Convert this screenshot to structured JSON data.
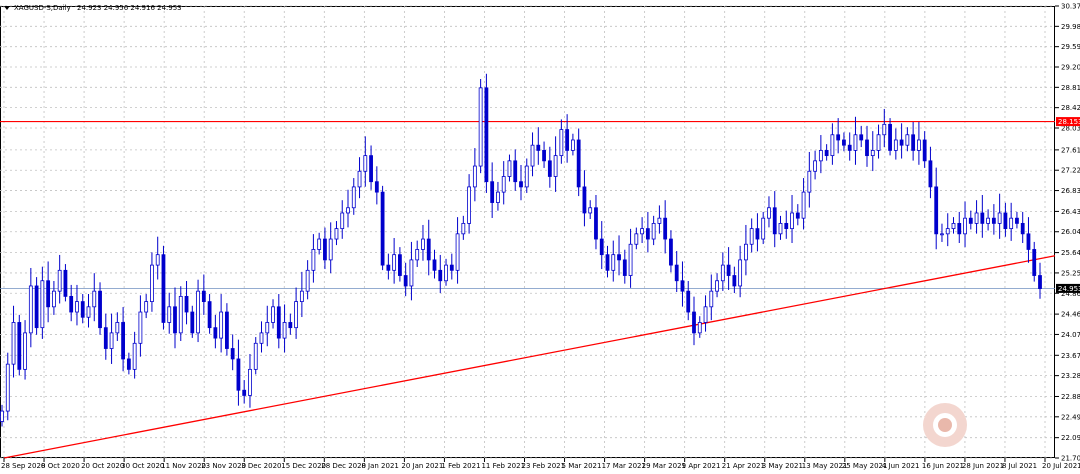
{
  "header": {
    "symbol": "XAGUSD-S,Daily",
    "ohlc": "24.923 24.956 24.916 24.953"
  },
  "colors": {
    "background": "#ffffff",
    "grid": "#c0c0c0",
    "candle": "#0000cc",
    "resistance": "#ff0000",
    "trendline": "#ff0000",
    "last_price_line": "#7090c0"
  },
  "chart_data": {
    "type": "candlestick",
    "title": "",
    "xlabel": "",
    "ylabel": "",
    "ylim": [
      21.7,
      30.37
    ],
    "grid": true,
    "y_ticks": [
      "30.370",
      "29.980",
      "29.590",
      "29.200",
      "28.810",
      "28.420",
      "28.030",
      "27.610",
      "27.220",
      "26.830",
      "26.430",
      "26.040",
      "25.640",
      "25.250",
      "24.860",
      "24.460",
      "24.070",
      "23.670",
      "23.280",
      "22.880",
      "22.490",
      "22.090",
      "21.700"
    ],
    "x_ticks": [
      "28 Sep 2020",
      "8 Oct 2020",
      "20 Oct 2020",
      "30 Oct 2020",
      "11 Nov 2020",
      "23 Nov 2020",
      "3 Dec 2020",
      "15 Dec 2020",
      "28 Dec 2020",
      "8 Jan 2021",
      "20 Jan 2021",
      "1 Feb 2021",
      "11 Feb 2021",
      "23 Feb 2021",
      "5 Mar 2021",
      "17 Mar 2021",
      "29 Mar 2021",
      "9 Apr 2021",
      "21 Apr 2021",
      "3 May 2021",
      "13 May 2021",
      "25 May 2021",
      "4 Jun 2021",
      "16 Jun 2021",
      "28 Jun 2021",
      "8 Jul 2021",
      "20 Jul 2021"
    ],
    "horizontal_line": {
      "value": 28.153,
      "label": "28.153"
    },
    "current_price": {
      "value": 24.953,
      "label": "24.953"
    },
    "trendline": {
      "start": {
        "date": "28 Sep 2020",
        "price": 21.7
      },
      "end": {
        "date": "20 Jul 2021",
        "price": 25.58
      }
    },
    "closes": [
      22.6,
      23.5,
      24.3,
      23.4,
      24.1,
      25.0,
      24.2,
      25.1,
      24.6,
      24.9,
      25.3,
      24.8,
      24.5,
      24.7,
      24.4,
      24.6,
      24.9,
      24.2,
      23.8,
      24.1,
      24.3,
      23.6,
      23.4,
      23.9,
      24.5,
      24.7,
      25.4,
      25.6,
      24.3,
      24.6,
      24.1,
      24.8,
      24.5,
      24.1,
      24.9,
      24.7,
      24.2,
      24.0,
      24.5,
      23.8,
      23.6,
      23.0,
      22.9,
      23.4,
      23.9,
      24.1,
      24.3,
      24.6,
      24.0,
      24.3,
      24.2,
      24.7,
      24.9,
      25.3,
      25.7,
      25.9,
      25.5,
      25.9,
      26.1,
      26.4,
      26.5,
      26.9,
      27.2,
      27.5,
      27.0,
      26.8,
      25.4,
      25.3,
      25.6,
      25.2,
      25.0,
      25.5,
      25.7,
      25.9,
      25.5,
      25.3,
      25.1,
      25.4,
      25.3,
      26.0,
      26.2,
      26.9,
      27.3,
      28.8,
      27.0,
      26.6,
      26.8,
      27.1,
      27.4,
      27.0,
      26.9,
      27.3,
      27.7,
      27.6,
      27.4,
      27.1,
      27.5,
      28.0,
      27.6,
      27.8,
      26.9,
      26.4,
      26.5,
      25.9,
      25.6,
      25.3,
      25.6,
      25.5,
      25.2,
      25.8,
      26.0,
      26.1,
      25.9,
      26.2,
      26.3,
      25.9,
      25.4,
      25.1,
      24.9,
      24.5,
      24.1,
      24.3,
      24.6,
      24.9,
      25.1,
      25.4,
      25.2,
      25.0,
      25.5,
      25.8,
      26.1,
      25.9,
      26.3,
      26.5,
      26.0,
      26.2,
      26.1,
      26.4,
      26.3,
      26.8,
      27.2,
      27.4,
      27.6,
      27.5,
      27.9,
      27.8,
      27.7,
      27.6,
      27.9,
      27.8,
      27.5,
      27.6,
      27.9,
      28.1,
      27.6,
      27.8,
      27.7,
      27.9,
      27.6,
      27.8,
      27.4,
      26.9,
      26.0,
      26.0,
      26.1,
      26.2,
      26.0,
      26.3,
      26.2,
      26.4,
      26.2,
      26.3,
      26.2,
      26.4,
      26.1,
      26.3,
      26.2,
      26.0,
      25.7,
      25.2,
      24.95
    ]
  }
}
